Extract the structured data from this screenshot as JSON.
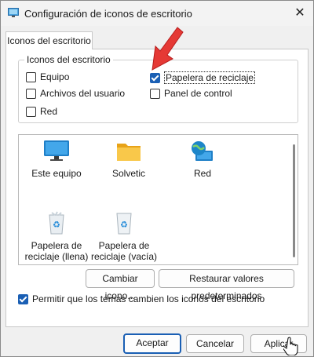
{
  "window": {
    "title": "Configuración de iconos de escritorio",
    "close_glyph": "✕"
  },
  "tabs": [
    {
      "label": "Iconos del escritorio",
      "selected": true
    }
  ],
  "group": {
    "legend": "Iconos del escritorio",
    "checkboxes": [
      {
        "label": "Equipo",
        "checked": false
      },
      {
        "label": "Archivos del usuario",
        "checked": false
      },
      {
        "label": "Red",
        "checked": false
      },
      {
        "label": "Papelera de reciclaje",
        "checked": true
      },
      {
        "label": "Panel de control",
        "checked": false
      }
    ]
  },
  "icons": [
    {
      "label": "Este equipo",
      "icon": "monitor-icon"
    },
    {
      "label": "Solvetic",
      "icon": "folder-icon"
    },
    {
      "label": "Red",
      "icon": "network-globe-icon"
    },
    {
      "label": "Papelera de reciclaje (llena)",
      "icon": "recycle-bin-full-icon"
    },
    {
      "label": "Papelera de reciclaje (vacía)",
      "icon": "recycle-bin-empty-icon"
    }
  ],
  "buttons": {
    "change_icon": "Cambiar icono...",
    "restore_defaults": "Restaurar valores predeterminados",
    "accept": "Aceptar",
    "cancel": "Cancelar",
    "apply": "Aplicar"
  },
  "themes_checkbox": {
    "label": "Permitir que los temas cambien los iconos del escritorio",
    "checked": true
  },
  "colors": {
    "accent": "#1a5fb4",
    "arrow": "#e53935"
  }
}
